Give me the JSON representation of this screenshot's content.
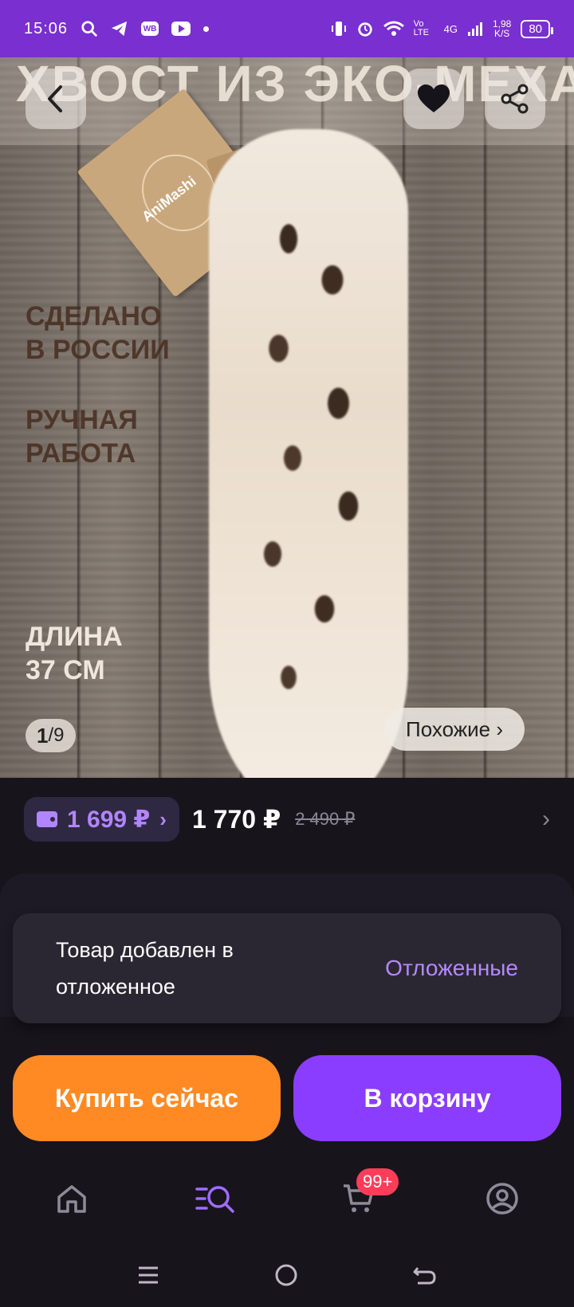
{
  "status_bar": {
    "time": "15:06",
    "wb_label": "WB",
    "network": "4G",
    "volte": "Vo LTE",
    "speed_value": "1,98",
    "speed_unit": "K/S",
    "battery": "80"
  },
  "hero": {
    "title": "ХВОСТ ИЗ ЭКО-МЕХА",
    "brand": "AniMashi",
    "made_in_line1": "СДЕЛАНО",
    "made_in_line2": "В РОССИИ",
    "handmade_line1": "РУЧНАЯ",
    "handmade_line2": "РАБОТА",
    "length_line1": "ДЛИНА",
    "length_line2": "37 СМ",
    "pager_current": "1",
    "pager_total": "9",
    "similar_label": "Похожие ›"
  },
  "price": {
    "wallet_price": "1 699 ₽",
    "main_price": "1 770 ₽",
    "old_price": "2 490 ₽"
  },
  "toast": {
    "message": "Товар добавлен в отложенное",
    "action": "Отложенные"
  },
  "actions": {
    "buy_now": "Купить сейчас",
    "add_to_cart": "В корзину"
  },
  "nav": {
    "cart_badge": "99+"
  },
  "colors": {
    "brand_purple": "#7a2fd0",
    "buy_orange": "#ff8a24",
    "cart_purple": "#8b3dff",
    "badge_red": "#ff3d5a"
  }
}
